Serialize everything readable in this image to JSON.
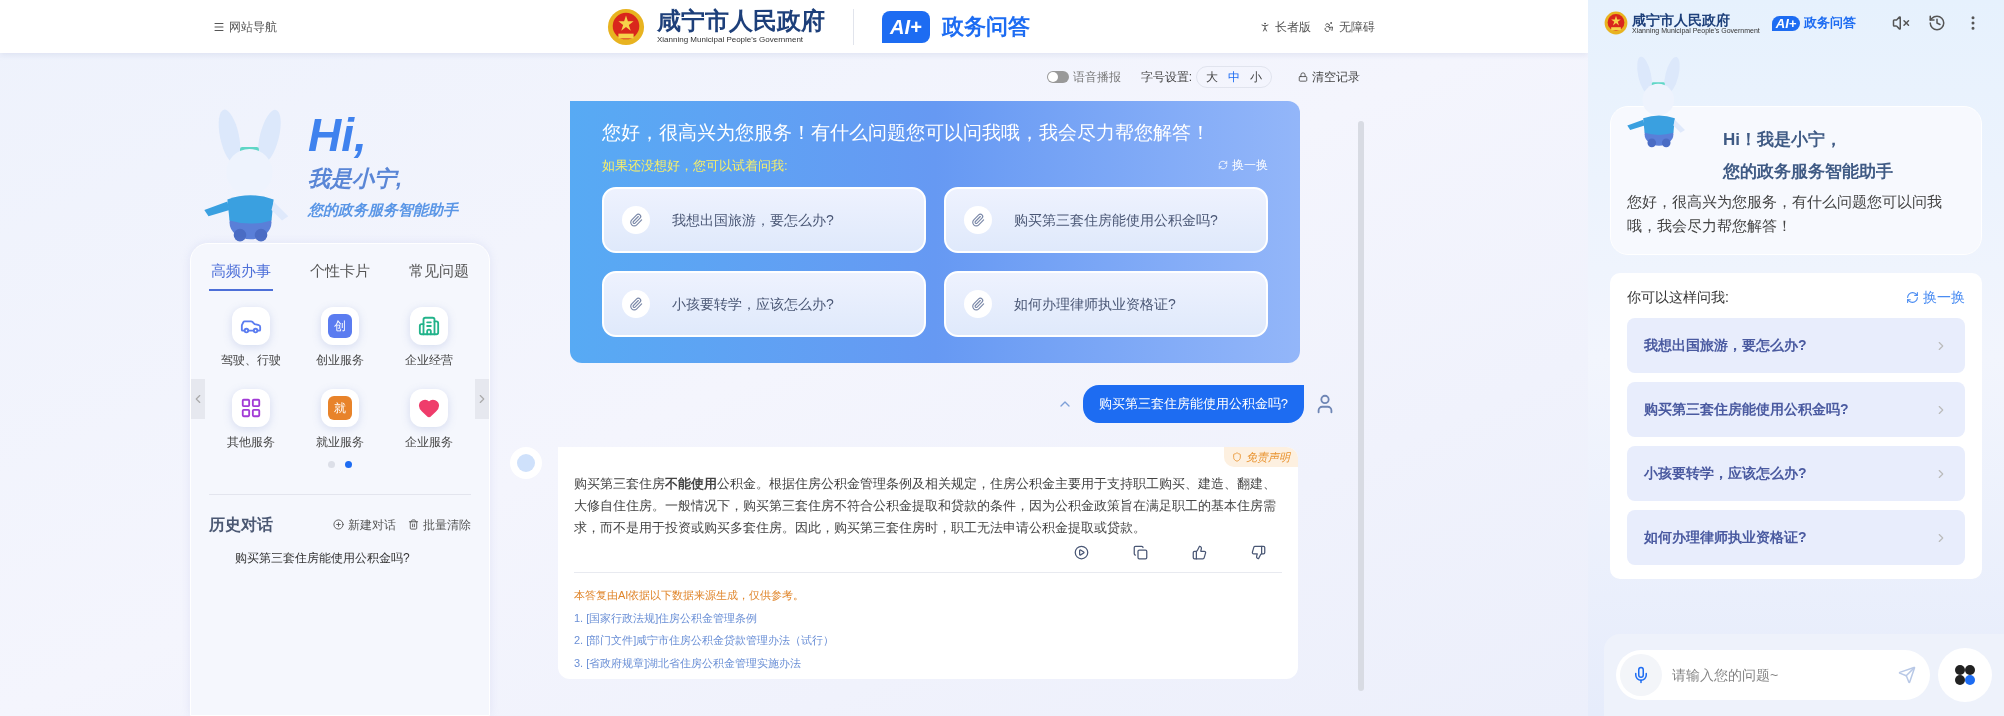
{
  "header": {
    "nav": "网站导航",
    "org_name": "咸宁市人民政府",
    "org_name_en": "Xianning Municipal People's Government",
    "badge": "AI+",
    "product": "政务问答",
    "links": [
      {
        "kind": "elder",
        "label": "长者版"
      },
      {
        "kind": "access",
        "label": "无障碍"
      }
    ]
  },
  "toolbar": {
    "voice": {
      "label": "语音播报",
      "on": false
    },
    "font_size": {
      "label": "字号设置:",
      "options": [
        {
          "label": "大",
          "selected": false
        },
        {
          "label": "中",
          "selected": true
        },
        {
          "label": "小",
          "selected": false
        }
      ]
    },
    "clear": "清空记录"
  },
  "sidebar": {
    "greeting": "Hi,",
    "intro": "我是小宁,",
    "tagline": "您的政务服务智能助手",
    "tabs": [
      {
        "label": "高频办事",
        "selected": true
      },
      {
        "label": "个性卡片",
        "selected": false
      },
      {
        "label": "常见问题",
        "selected": false
      }
    ],
    "services": [
      {
        "label": "驾驶、行驶",
        "kind": "car",
        "color": "#5b7cf0"
      },
      {
        "label": "创业服务",
        "kind": "hex",
        "glyph": "创",
        "color": "#5b7cf0"
      },
      {
        "label": "企业经营",
        "kind": "building",
        "color": "#22b38a"
      },
      {
        "label": "其他服务",
        "kind": "grid",
        "color": "#a23bd6"
      },
      {
        "label": "就业服务",
        "kind": "hex",
        "glyph": "就",
        "color": "#e8832a"
      },
      {
        "label": "企业服务",
        "kind": "heart",
        "color": "#ef3d6b"
      }
    ],
    "pages": [
      {
        "selected": false
      },
      {
        "selected": true
      }
    ],
    "history": {
      "title": "历史对话",
      "new": "新建对话",
      "clear": "批量清除",
      "items": [
        "购买第三套住房能使用公积金吗?"
      ]
    }
  },
  "chat": {
    "welcome": {
      "title": "您好，很高兴为您服务！有什么问题您可以问我哦，我会尽力帮您解答！",
      "hint": "如果还没想好，您可以试着问我:",
      "refresh": "换一换",
      "suggestions": [
        "我想出国旅游，要怎么办?",
        "购买第三套住房能使用公积金吗?",
        "小孩要转学，应该怎么办?",
        "如何办理律师执业资格证?"
      ]
    },
    "messages": [
      {
        "kind": "user",
        "text": "购买第三套住房能使用公积金吗?"
      },
      {
        "kind": "bot",
        "disclaimer": "免责声明",
        "text": "购买第三套住房**不能使用**公积金。根据住房公积金管理条例及相关规定，住房公积金主要用于支持职工购买、建造、翻建、大修自住住房。一般情况下，购买第三套住房不符合公积金提取和贷款的条件，因为公积金政策旨在满足职工的基本住房需求，而不是用于投资或购买多套住房。因此，购买第三套住房时，职工无法申请公积金提取或贷款。",
        "note": "本答复由AI依据以下数据来源生成，仅供参考。",
        "sources": [
          "1. [国家行政法规]住房公积金管理条例",
          "2. [部门文件]咸宁市住房公积金贷款管理办法（试行）",
          "3. [省政府规章]湖北省住房公积金管理实施办法"
        ]
      }
    ]
  },
  "panel": {
    "org_name": "咸宁市人民政府",
    "org_name_en": "Xianning Municipal People's Government",
    "badge": "AI+",
    "product": "政务问答",
    "greeting": "Hi！我是小宁，",
    "tagline": "您的政务服务智能助手",
    "welcome": "您好，很高兴为您服务，有什么问题您可以问我哦，我会尽力帮您解答！",
    "prompt": "你可以这样问我:",
    "refresh": "换一换",
    "suggestions": [
      "我想出国旅游，要怎么办?",
      "购买第三套住房能使用公积金吗?",
      "小孩要转学，应该怎么办?",
      "如何办理律师执业资格证?"
    ],
    "input": {
      "placeholder": "请输入您的问题~"
    }
  }
}
